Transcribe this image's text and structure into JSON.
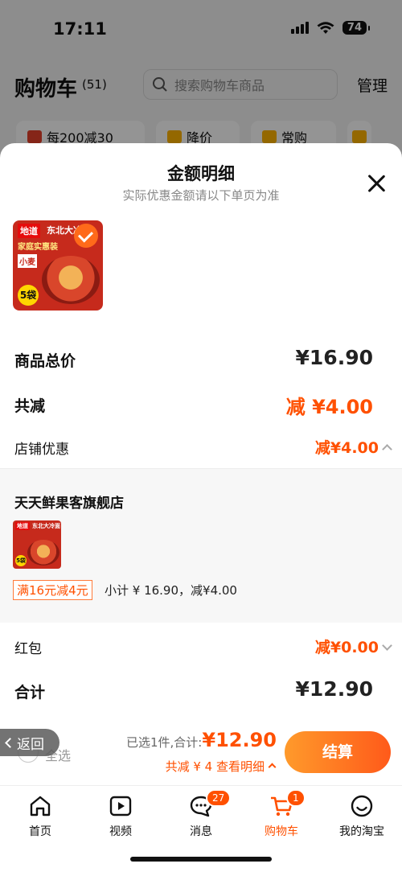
{
  "status_bar": {
    "time": "17:11",
    "battery": "74"
  },
  "cart": {
    "title": "购物车",
    "count": "(51)",
    "search_placeholder": "搜索购物车商品",
    "manage_label": "管理",
    "chips": [
      "每200减30",
      "降价",
      "常购"
    ]
  },
  "sheet": {
    "title": "金额明细",
    "subtitle": "实际优惠金额请以下单页为准",
    "product_image_text": {
      "tag1": "地道",
      "tag2": "东北大冷面",
      "tag3": "家庭实惠装",
      "tag4": "小麦",
      "badge": "5袋"
    },
    "rows": {
      "total_price_label": "商品总价",
      "total_price_value": "¥16.90",
      "discount_label": "共减",
      "discount_value": "减 ¥4.00",
      "shop_discount_label": "店铺优惠",
      "shop_discount_value": "减¥4.00",
      "red_packet_label": "红包",
      "red_packet_value": "减¥0.00",
      "sum_label": "合计",
      "sum_value": "¥12.90"
    },
    "shop": {
      "name": "天天鲜果客旗舰店",
      "promo_tag": "满16元减4元",
      "promo_detail": "小计 ¥ 16.90，减¥4.00"
    }
  },
  "bottom_bar": {
    "back_label": "返回",
    "select_all_label": "全选",
    "selected_prefix": "已选1件,合计:",
    "selected_total": "¥12.90",
    "detail_link": "共减 ¥ 4  查看明细",
    "checkout_label": "结算"
  },
  "tabs": [
    {
      "label": "首页",
      "icon": "home-icon"
    },
    {
      "label": "视频",
      "icon": "video-icon"
    },
    {
      "label": "消息",
      "icon": "message-icon",
      "badge": "27"
    },
    {
      "label": "购物车",
      "icon": "cart-icon",
      "badge": "1",
      "active": true
    },
    {
      "label": "我的淘宝",
      "icon": "profile-icon"
    }
  ],
  "colors": {
    "accent": "#ff5000",
    "overlay": "rgba(0,0,0,0.42)"
  }
}
